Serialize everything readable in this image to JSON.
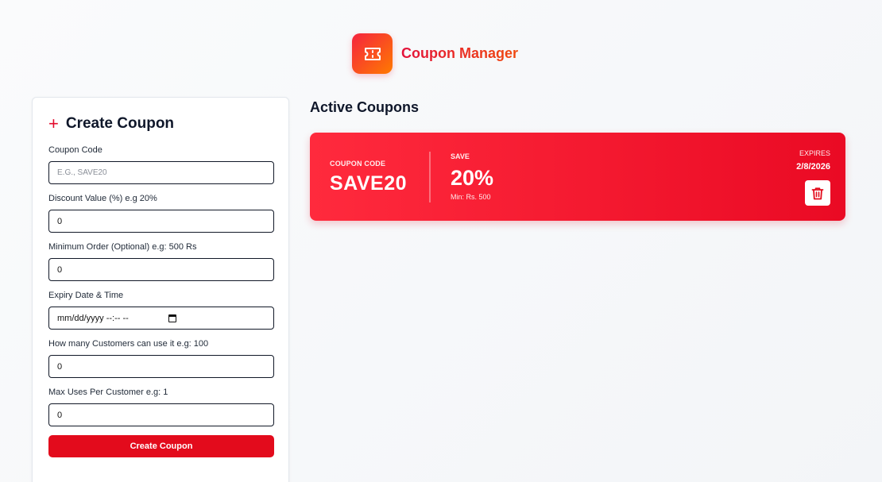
{
  "header": {
    "title": "Coupon Manager",
    "logo_icon": "ticket-icon",
    "accent": "#e3123b"
  },
  "form": {
    "title": "Create Coupon",
    "plus_icon": "plus-icon",
    "fields": [
      {
        "label": "Coupon Code",
        "placeholder": "E.G., SAVE20",
        "value": ""
      },
      {
        "label": "Discount Value (%) e.g 20%",
        "value": "0"
      },
      {
        "label": "Minimum Order (Optional) e.g: 500 Rs",
        "value": "0"
      },
      {
        "label": "Expiry Date & Time",
        "value": "mm/dd/yyyy --:-- --"
      },
      {
        "label": "How many Customers can use it e.g: 100",
        "value": "0"
      },
      {
        "label": "Max Uses Per Customer e.g: 1",
        "value": "0"
      }
    ],
    "submit_label": "Create Coupon"
  },
  "active": {
    "title": "Active Coupons",
    "coupons": [
      {
        "code_label": "COUPON CODE",
        "code": "SAVE20",
        "save_label": "SAVE",
        "save": "20%",
        "min": "Min: Rs. 500",
        "expires_label": "EXPIRES",
        "expires": "2/8/2026",
        "delete_icon": "trash-icon",
        "color": "#ea0a24"
      }
    ]
  }
}
